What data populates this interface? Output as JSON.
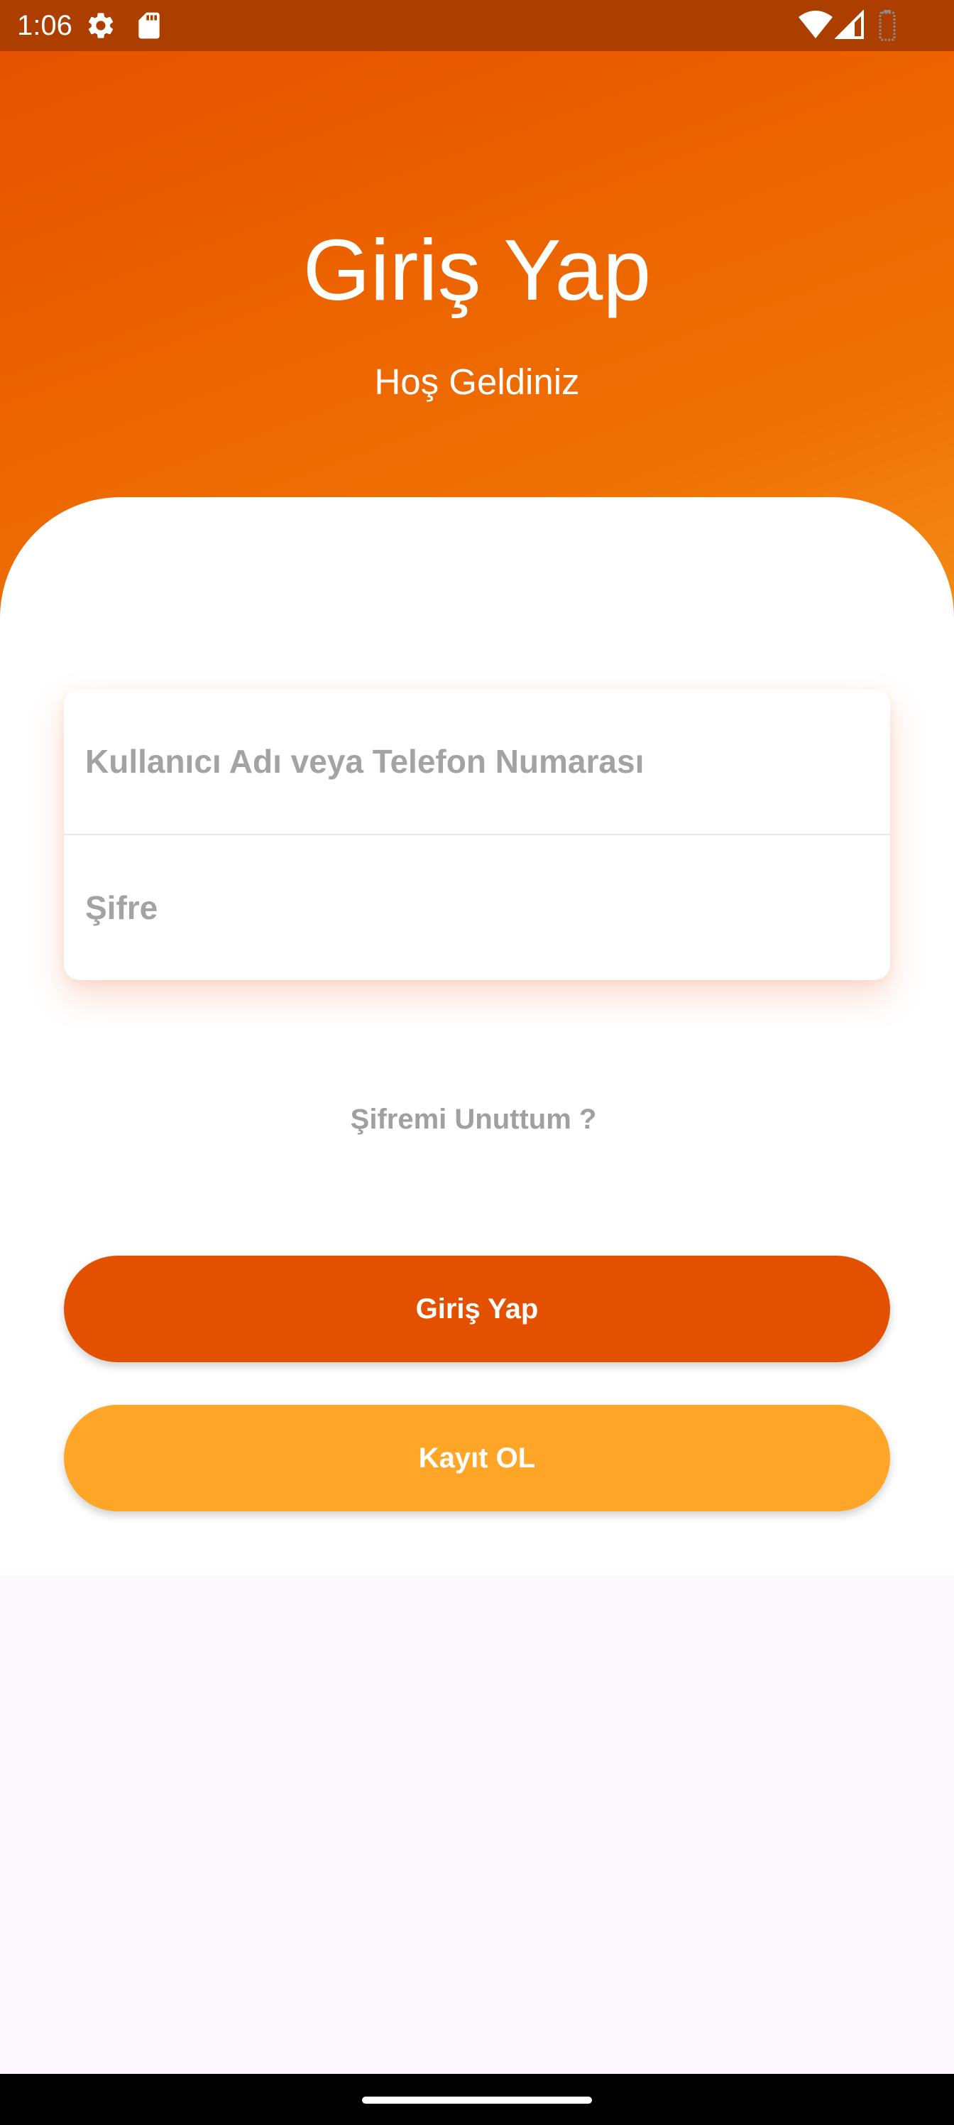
{
  "status_bar": {
    "time": "1:06",
    "icons": [
      "settings-icon",
      "sd-card-icon",
      "wifi-icon",
      "signal-icon",
      "battery-icon"
    ]
  },
  "header": {
    "title": "Giriş Yap",
    "subtitle": "Hoş Geldiniz"
  },
  "form": {
    "username_placeholder": "Kullanıcı Adı veya Telefon Numarası",
    "username_value": "",
    "password_placeholder": "Şifre",
    "password_value": ""
  },
  "forgot_password": "Şifremi Unuttum ?",
  "buttons": {
    "login": "Giriş Yap",
    "register": "Kayıt OL"
  },
  "colors": {
    "status_bar": "#ac3f00",
    "header_start": "#e65200",
    "header_end": "#f5901a",
    "login_button": "#e35100",
    "register_button": "#ffa629",
    "placeholder_text": "#a3a3a3",
    "page_background": "#fcf6fd"
  }
}
